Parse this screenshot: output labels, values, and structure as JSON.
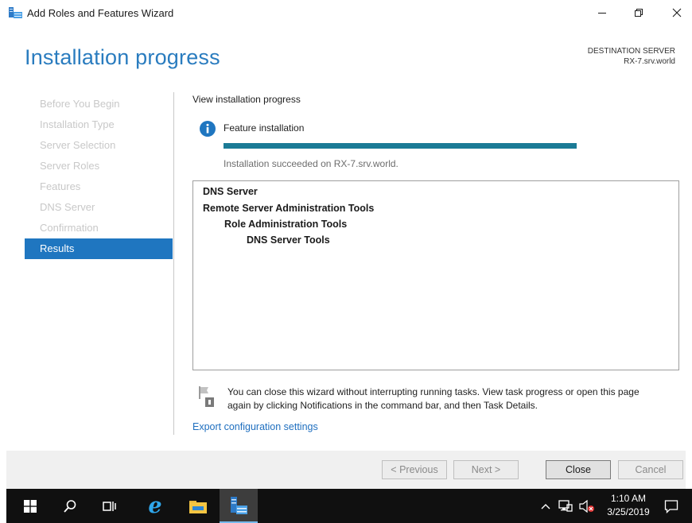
{
  "window": {
    "title": "Add Roles and Features Wizard",
    "controls": [
      "minimize",
      "maximize",
      "close"
    ]
  },
  "header": {
    "page_title": "Installation progress",
    "destination_label": "DESTINATION SERVER",
    "destination_server": "RX-7.srv.world"
  },
  "nav": {
    "items": [
      {
        "label": "Before You Begin",
        "state": "disabled"
      },
      {
        "label": "Installation Type",
        "state": "disabled"
      },
      {
        "label": "Server Selection",
        "state": "disabled"
      },
      {
        "label": "Server Roles",
        "state": "disabled"
      },
      {
        "label": "Features",
        "state": "disabled"
      },
      {
        "label": "DNS Server",
        "state": "disabled"
      },
      {
        "label": "Confirmation",
        "state": "disabled"
      },
      {
        "label": "Results",
        "state": "active"
      }
    ]
  },
  "main": {
    "view_label": "View installation progress",
    "feature_label": "Feature installation",
    "progress": 1.0,
    "status_text": "Installation succeeded on RX-7.srv.world.",
    "results": [
      {
        "label": "DNS Server",
        "level": 0
      },
      {
        "label": "Remote Server Administration Tools",
        "level": 0
      },
      {
        "label": "Role Administration Tools",
        "level": 1
      },
      {
        "label": "DNS Server Tools",
        "level": 2
      }
    ],
    "notice_line1": "You can close this wizard without interrupting running tasks. View task progress or open this page",
    "notice_line2": "again by clicking Notifications in the command bar, and then Task Details.",
    "export_link": "Export configuration settings"
  },
  "footer": {
    "previous_label": "< Previous",
    "next_label": "Next >",
    "close_label": "Close",
    "cancel_label": "Cancel"
  },
  "taskbar": {
    "icons": [
      "windows-start-icon",
      "search-icon",
      "task-view-icon",
      "internet-explorer-icon",
      "file-explorer-icon",
      "server-manager-icon"
    ],
    "time": "1:10 AM",
    "date": "3/25/2019"
  },
  "colors": {
    "accent": "#1f76c0",
    "title": "#2a7cbf",
    "progress": "#1b7b96",
    "taskbar": "#101010"
  }
}
